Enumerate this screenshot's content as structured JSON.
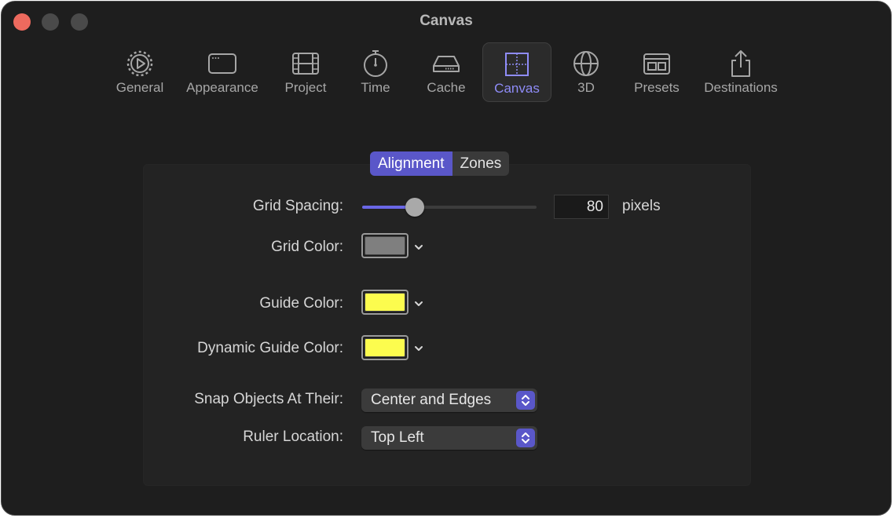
{
  "window": {
    "title": "Canvas"
  },
  "toolbar": {
    "items": [
      {
        "label": "General",
        "icon": "gear-icon"
      },
      {
        "label": "Appearance",
        "icon": "window-icon"
      },
      {
        "label": "Project",
        "icon": "film-icon"
      },
      {
        "label": "Time",
        "icon": "stopwatch-icon"
      },
      {
        "label": "Cache",
        "icon": "drive-icon"
      },
      {
        "label": "Canvas",
        "icon": "canvas-grid-icon",
        "selected": true
      },
      {
        "label": "3D",
        "icon": "sphere-icon"
      },
      {
        "label": "Presets",
        "icon": "presets-icon"
      },
      {
        "label": "Destinations",
        "icon": "share-icon"
      }
    ]
  },
  "tabs": {
    "alignment": "Alignment",
    "zones": "Zones",
    "selected": "Alignment"
  },
  "settings": {
    "grid_spacing": {
      "label": "Grid Spacing:",
      "value": "80",
      "unit": "pixels",
      "slider_fraction": 0.3
    },
    "grid_color": {
      "label": "Grid Color:",
      "color": "#7f7f7f"
    },
    "guide_color": {
      "label": "Guide Color:",
      "color": "#fcfc4e"
    },
    "dynamic_guide_color": {
      "label": "Dynamic Guide Color:",
      "color": "#fcfc4e"
    },
    "snap_objects": {
      "label": "Snap Objects At Their:",
      "value": "Center and Edges"
    },
    "ruler_location": {
      "label": "Ruler Location:",
      "value": "Top Left"
    }
  },
  "colors": {
    "accent": "#5a57c9",
    "close": "#ed6a5e"
  }
}
